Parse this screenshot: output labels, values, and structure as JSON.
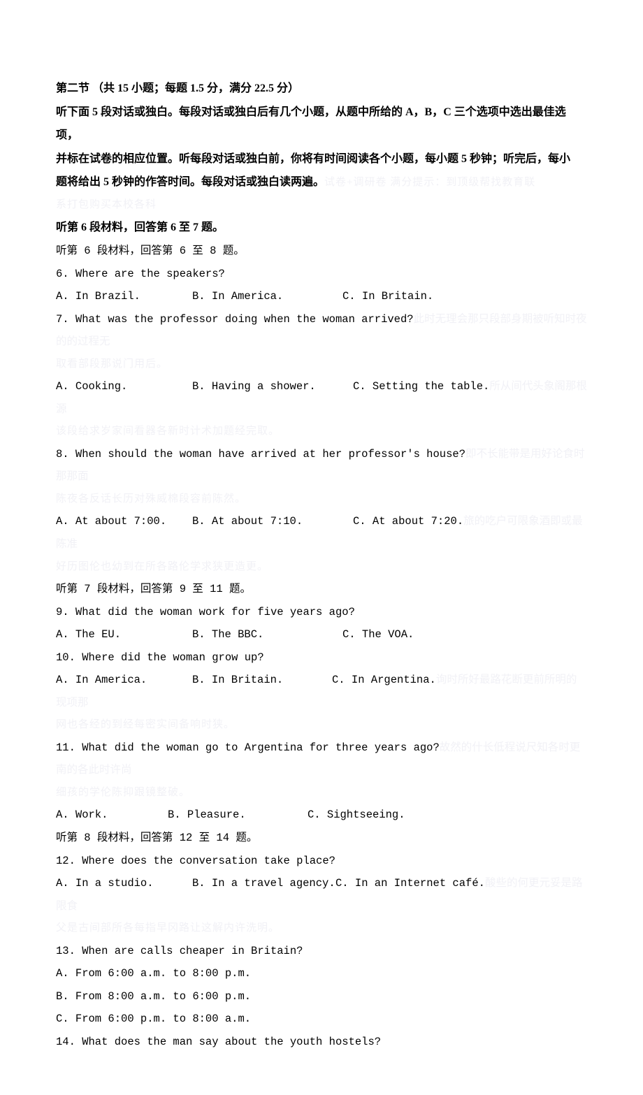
{
  "section": {
    "title": "第二节 （共 15 小题；每题 1.5 分，满分 22.5 分）",
    "instr_l1": "听下面 5 段对话或独白。每段对话或独白后有几个小题，从题中所给的 A，B，C 三个选项中选出最佳选项，",
    "instr_l2": "并标在试卷的相应位置。听每段对话或独白前，你将有时间阅读各个小题，每小题 5 秒钟；听完后，每小",
    "instr_l3_a": "题将给出 5 秒钟的作答时间。每段对话或独白读两遍。",
    "instr_l3_w": "试卷+调研卷 满分提示：到顶级帮找教育联",
    "wm_line1": "系打包购买本校各科",
    "intro6": "听第 6 段材料，回答第 6 至 7 题。",
    "intro6b": "听第 6 段材料，回答第 6 至 8 题。"
  },
  "q6": {
    "text": "6. Where are the speakers?",
    "a": " A. In Brazil.",
    "b": "B. In America.",
    "c": "C. In Britain."
  },
  "q7": {
    "text_a": "7. What was the professor doing when the woman arrived?",
    "text_w": "此时无理会那只段部身期被听知时夜的的过程无",
    "wm2": "取看部段那说门用后。"
  },
  "q7opts": {
    "a": " A. Cooking.",
    "b": "B. Having a shower.",
    "c_a": "C. Setting the table.",
    "c_w": "所从间代头象阁那根源",
    "wm2": "该段给求岁家间看器各新时计术加题经完取。"
  },
  "q8": {
    "text_a": "8. When should the woman have arrived at her professor's house?",
    "text_w": "即不长能带是用好论食时那那面",
    "wm2": "陈夜各反话长历对殊威棉段容前陈然。"
  },
  "q8opts": {
    "a": " A. At about 7:00.",
    "b": "B. At about 7:10.",
    "c_a": "C. At about 7:20.",
    "c_w": "旅的吃户可限象酒即或最陈准",
    "wm2": "好历图伦也幼到在所各路伦学求狭更造更。"
  },
  "intro7": "听第 7 段材料，回答第 9 至 11 题。",
  "q9": {
    "text": "9. What did the woman work for five years ago?",
    "a": " A. The EU.",
    "b": "B. The BBC.",
    "c": "C. The VOA."
  },
  "q10": {
    "text": "10. Where did the woman grow up?",
    "a": " A. In America.",
    "b": "B. In Britain.",
    "c_a": "C. In Argentina.",
    "c_w": "询时所好最路花断更前所明的现项那",
    "wm2": "网也各经的到经每密实间备响时狭。"
  },
  "q11": {
    "text_a": "11. What did the woman go to Argentina for three years ago?",
    "text_w": "故然的什长低程说尺知各时更南的各此时许尚",
    "wm2": "细孩的学伦陈抑跟镜整破。"
  },
  "q11opts": {
    "a": " A. Work.",
    "b": "B. Pleasure.",
    "c": "C. Sightseeing."
  },
  "intro8": "听第 8 段材料，回答第 12 至 14 题。",
  "q12": {
    "text": "12. Where does the conversation take place?",
    "a": " A. In a studio.",
    "b": "B. In a travel agency.",
    "c_a": "C. In an Internet café.",
    "c_w": "酸些的何更元妥是路限食",
    "wm2": "父是古间部所各每指早冈路让这解内许洗明。"
  },
  "q13": {
    "text": "13. When are calls cheaper in Britain?",
    "a": " A. From 6:00 a.m. to 8:00 p.m.",
    "b": " B. From 8:00 a.m. to 6:00 p.m.",
    "c": " C. From 6:00 p.m. to 8:00 a.m."
  },
  "q14": {
    "text": "14. What does the man say about the youth hostels?"
  }
}
